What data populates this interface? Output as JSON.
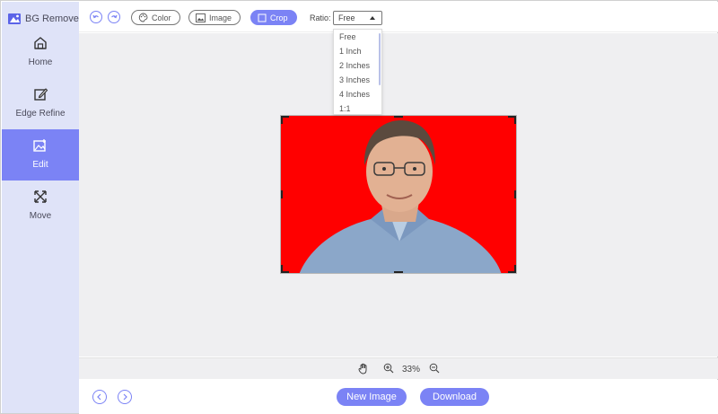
{
  "app": {
    "title": "BG Remover"
  },
  "sidebar": {
    "items": [
      {
        "label": "Home",
        "icon": "home-icon",
        "active": false
      },
      {
        "label": "Edge Refine",
        "icon": "edge-refine-icon",
        "active": false
      },
      {
        "label": "Edit",
        "icon": "edit-image-icon",
        "active": true
      },
      {
        "label": "Move",
        "icon": "move-icon",
        "active": false
      }
    ]
  },
  "toolbar": {
    "undo_icon": "undo-icon",
    "redo_icon": "redo-icon",
    "color_label": "Color",
    "image_label": "Image",
    "crop_label": "Crop",
    "ratio_label": "Ratio:",
    "ratio_value": "Free"
  },
  "ratio_options": [
    "Free",
    "1 Inch",
    "2 Inches",
    "3 Inches",
    "4 Inches",
    "1:1"
  ],
  "zoom": {
    "value": "33%"
  },
  "footer": {
    "new_image_label": "New Image",
    "download_label": "Download"
  },
  "colors": {
    "accent": "#7b83f5",
    "sidebar_bg": "#dfe3f8",
    "canvas_bg": "#efeff1",
    "photo_bg": "#ff0000"
  }
}
